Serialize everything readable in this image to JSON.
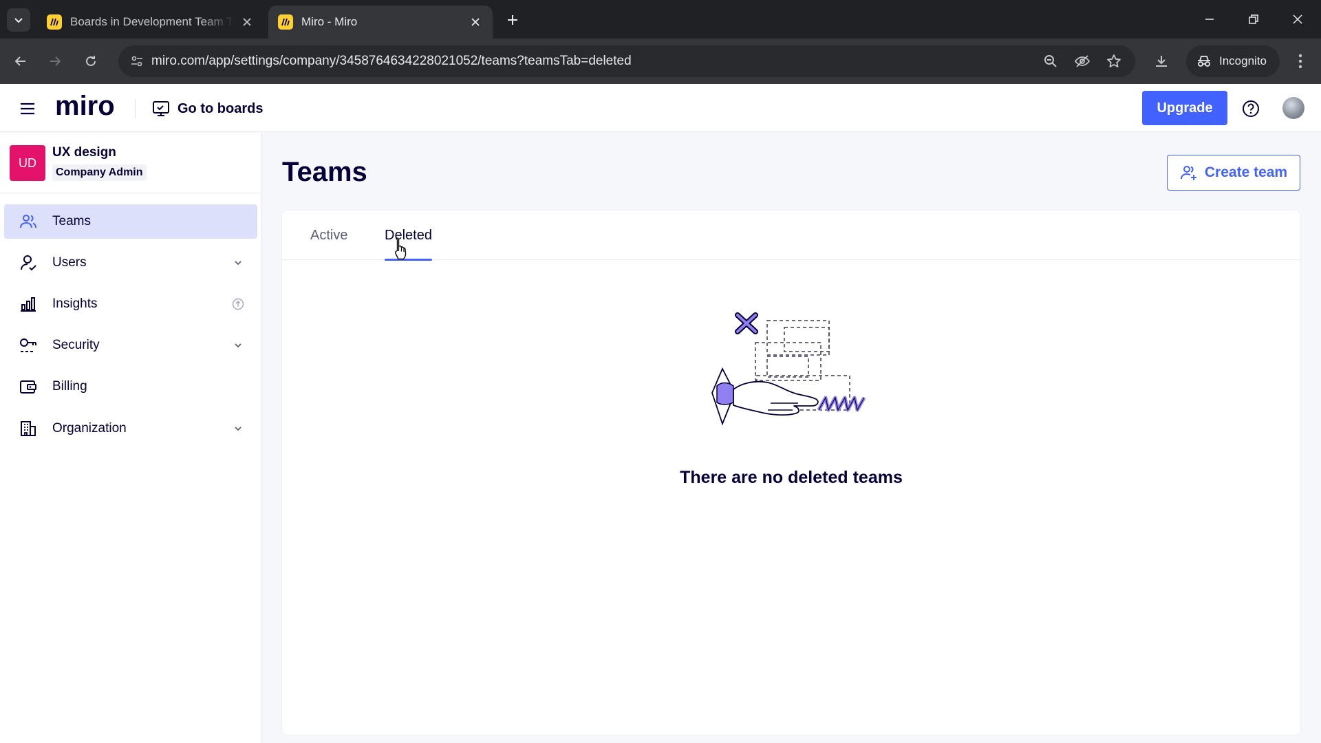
{
  "browser": {
    "tabs": [
      {
        "title": "Boards in Development Team Te",
        "active": false
      },
      {
        "title": "Miro - Miro",
        "active": true
      }
    ],
    "url": "miro.com/app/settings/company/3458764634228021052/teams?teamsTab=deleted",
    "incognito_label": "Incognito"
  },
  "header": {
    "logo": "miro",
    "goto_boards": "Go to boards",
    "upgrade": "Upgrade"
  },
  "sidebar": {
    "org": {
      "initials": "UD",
      "name": "UX design",
      "role": "Company Admin"
    },
    "items": [
      {
        "label": "Teams",
        "icon": "teams-icon",
        "selected": true
      },
      {
        "label": "Users",
        "icon": "user-icon",
        "expandable": true
      },
      {
        "label": "Insights",
        "icon": "bar-chart-icon",
        "badge": "upgrade-icon"
      },
      {
        "label": "Security",
        "icon": "key-icon",
        "expandable": true
      },
      {
        "label": "Billing",
        "icon": "wallet-icon"
      },
      {
        "label": "Organization",
        "icon": "building-icon",
        "expandable": true
      }
    ]
  },
  "main": {
    "title": "Teams",
    "create_team": "Create team",
    "tabs": [
      {
        "label": "Active",
        "active": false
      },
      {
        "label": "Deleted",
        "active": true
      }
    ],
    "empty_message": "There are no deleted teams"
  },
  "colors": {
    "accent": "#4262ff",
    "org_badge": "#e4126b",
    "selected_nav": "#dde0fb",
    "text": "#050038",
    "illustration_purple": "#8f7ff0"
  }
}
